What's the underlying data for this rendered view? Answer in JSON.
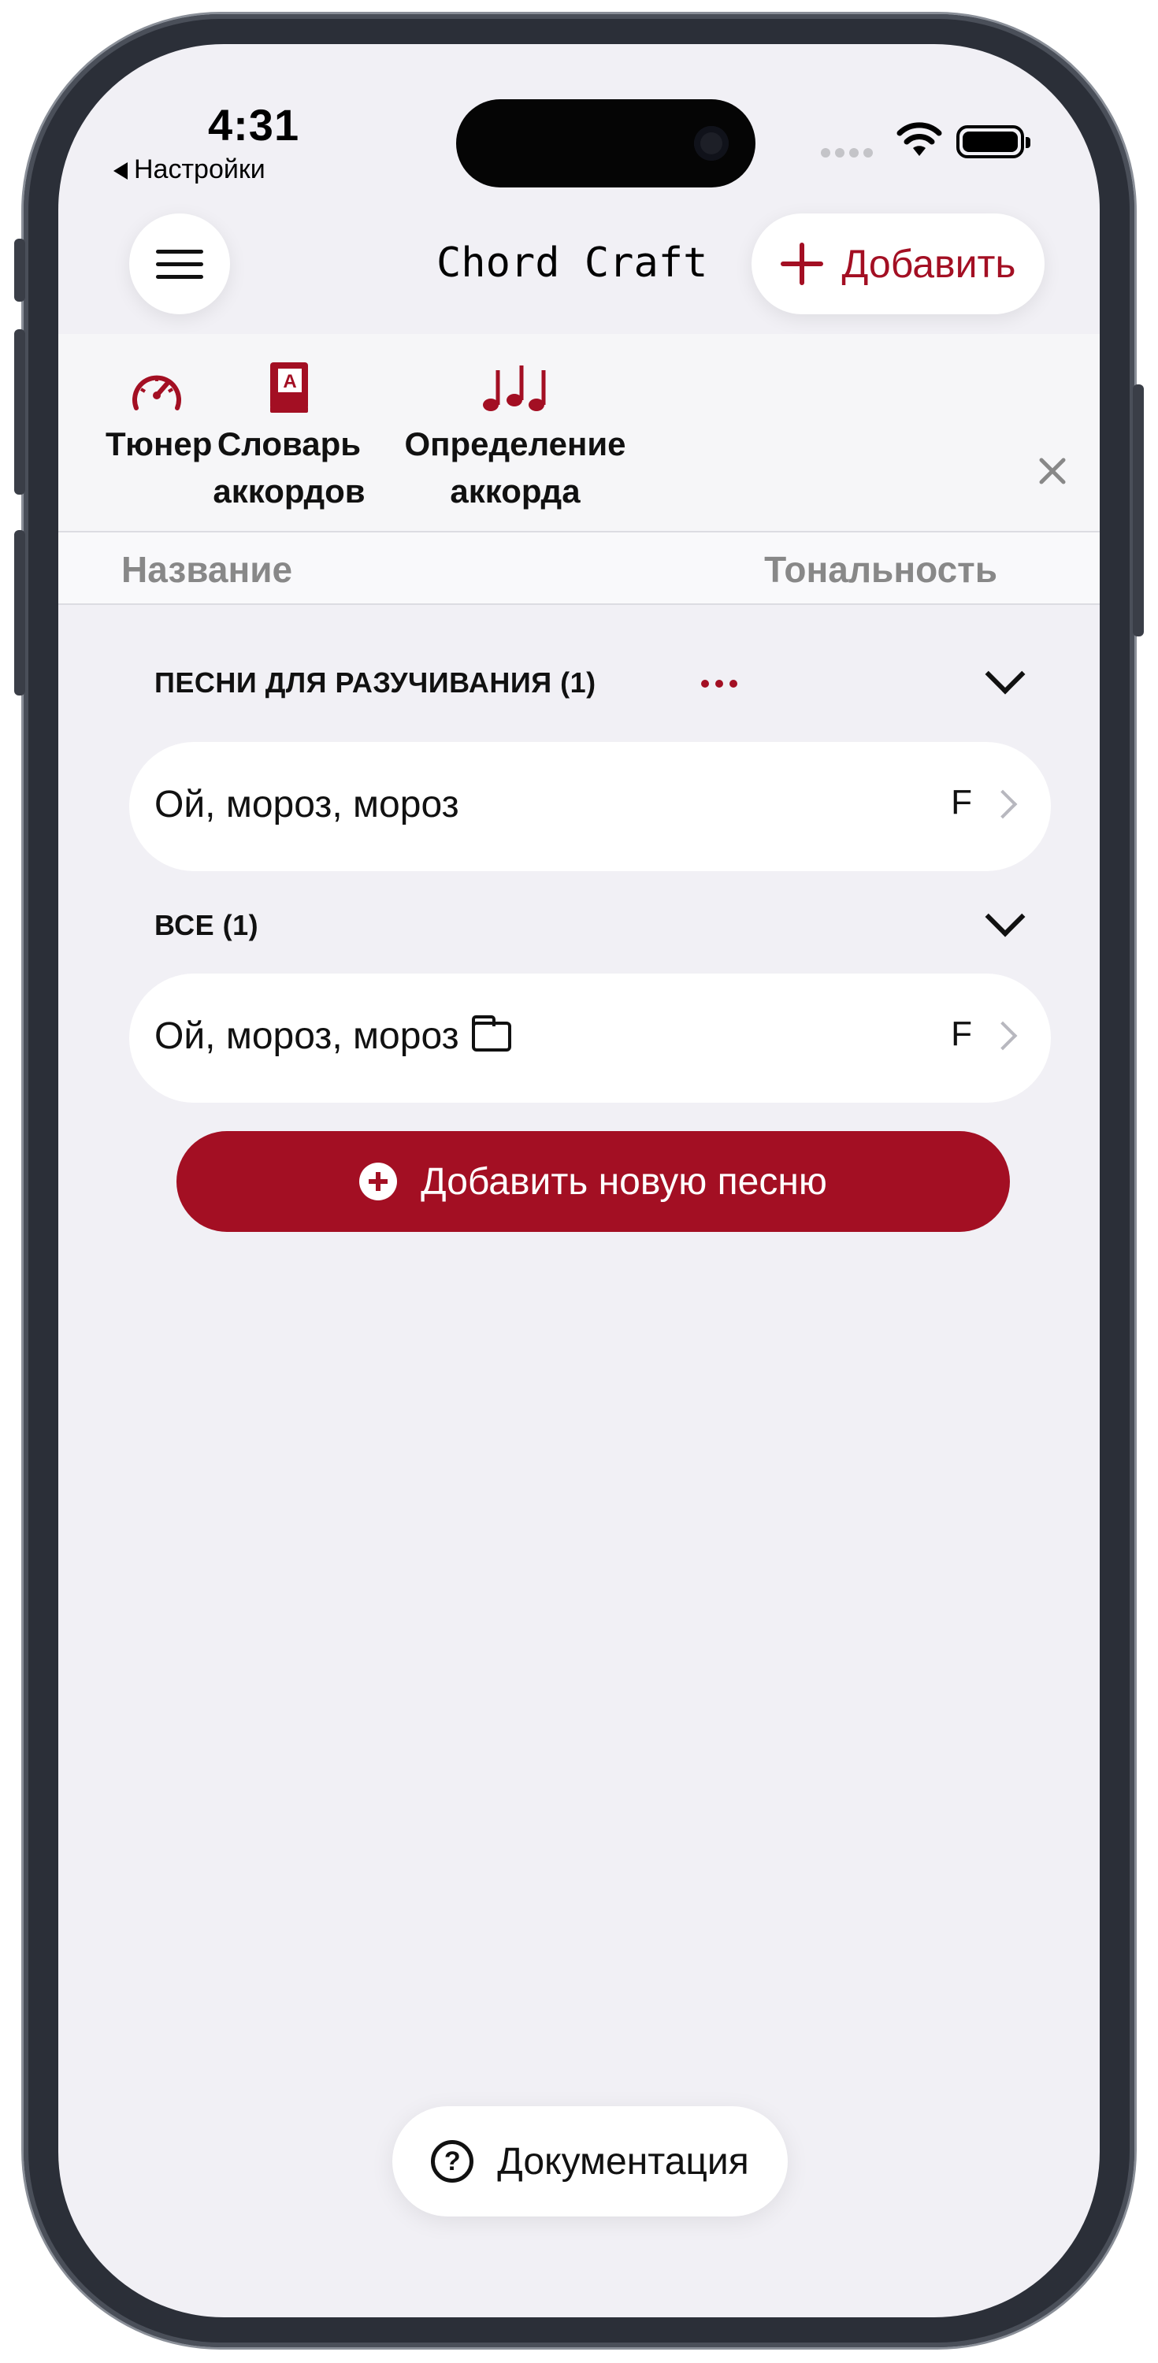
{
  "status_bar": {
    "time": "4:31",
    "back_label": "Настройки"
  },
  "header": {
    "title": "Chord Craft",
    "add_label": "Добавить"
  },
  "tools": [
    {
      "label_line1": "Тюнер",
      "label_line2": "",
      "icon": "speedometer-icon"
    },
    {
      "label_line1": "Словарь",
      "label_line2": "аккордов",
      "icon": "dictionary-book-icon"
    },
    {
      "label_line1": "Определение",
      "label_line2": "аккорда",
      "icon": "music-notes-icon"
    }
  ],
  "columns": {
    "name": "Название",
    "key": "Тональность"
  },
  "sections": [
    {
      "title": "ПЕСНИ ДЛЯ РАЗУЧИВАНИЯ (1)",
      "songs": [
        {
          "title": "Ой, мороз, мороз",
          "key": "F"
        }
      ]
    },
    {
      "title": "ВСЕ (1)",
      "songs": [
        {
          "title": "Ой, мороз, мороз",
          "key": "F",
          "icon": "folder-icon"
        }
      ]
    }
  ],
  "add_song_label": "Добавить новую песню",
  "docs_label": "Документация",
  "colors": {
    "accent": "#a30f23",
    "background": "#f1f0f5"
  }
}
